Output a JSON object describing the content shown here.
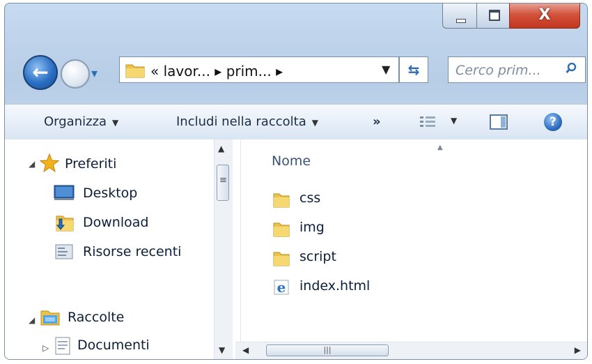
{
  "window": {
    "close_glyph": "X"
  },
  "address_bar": {
    "path_text": "« lavor... ▸ prim... ▸",
    "search_placeholder": "Cerco prim..."
  },
  "toolbar": {
    "organize_label": "Organizza",
    "include_label": "Includi nella raccolta",
    "more_label": "»"
  },
  "nav_pane": {
    "favorites_label": "Preferiti",
    "favorites_items": [
      {
        "label": "Desktop",
        "icon": "desktop-icon"
      },
      {
        "label": "Download",
        "icon": "download-folder-icon"
      },
      {
        "label": "Risorse recenti",
        "icon": "recent-places-icon"
      }
    ],
    "libraries_label": "Raccolte",
    "libraries_items": [
      {
        "label": "Documenti",
        "icon": "documents-icon"
      }
    ]
  },
  "content": {
    "column_header": "Nome",
    "files": [
      {
        "name": "css",
        "type": "folder"
      },
      {
        "name": "img",
        "type": "folder"
      },
      {
        "name": "script",
        "type": "folder"
      },
      {
        "name": "index.html",
        "type": "html"
      }
    ]
  },
  "colors": {
    "accent": "#2f6db4",
    "close_button": "#c2361f",
    "folder": "#e9c34b"
  }
}
